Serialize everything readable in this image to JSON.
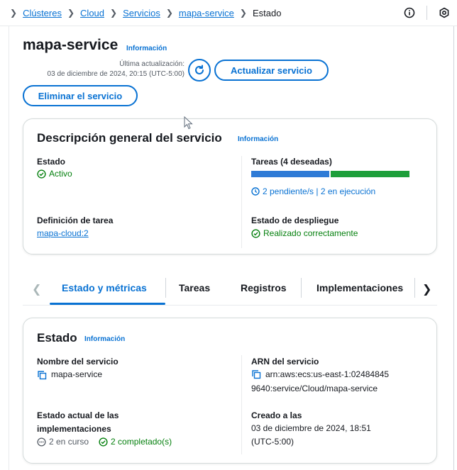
{
  "breadcrumb": {
    "items": [
      "Clústeres",
      "Cloud",
      "Servicios",
      "mapa-service"
    ],
    "current": "Estado"
  },
  "header": {
    "title": "mapa-service",
    "info": "Información",
    "last_update_label": "Última actualización:",
    "last_update_value": "03 de diciembre de 2024, 20:15 (UTC-5:00)",
    "update_button": "Actualizar servicio",
    "delete_button": "Eliminar el servicio"
  },
  "overview": {
    "title": "Descripción general del servicio",
    "info": "Información",
    "status_label": "Estado",
    "status_value": "Activo",
    "tasks_label": "Tareas (4 deseadas)",
    "tasks_summary": "2 pendiente/s | 2 en ejecución",
    "tasks_pending_fraction": 0.5,
    "tasks_running_fraction": 0.5,
    "task_def_label": "Definición de tarea",
    "task_def_value": "mapa-cloud:2",
    "deploy_label": "Estado de despliegue",
    "deploy_value": "Realizado correctamente"
  },
  "tabs": {
    "items": [
      "Estado y métricas",
      "Tareas",
      "Registros",
      "Implementaciones"
    ],
    "active": "Estado y métricas"
  },
  "status": {
    "title": "Estado",
    "info": "Información",
    "service_name_label": "Nombre del servicio",
    "service_name_value": "mapa-service",
    "arn_label": "ARN del servicio",
    "arn_line1": "arn:aws:ecs:us-east-1:02484845",
    "arn_line2": "9640:service/Cloud/mapa-service",
    "deploy_state_label_1": "Estado actual de las",
    "deploy_state_label_2": "implementaciones",
    "in_progress": "2 en curso",
    "completed": "2 completado(s)",
    "created_label": "Creado a las",
    "created_line1": "03 de diciembre de 2024, 18:51",
    "created_line2": "(UTC-5:00)"
  },
  "colors": {
    "link": "#0972d3",
    "success": "#037f0c",
    "bar_pending": "#2f7bd6",
    "bar_running": "#1e9f3b"
  },
  "icons": [
    "chevron-right-icon",
    "info-circle-icon",
    "settings-hex-icon",
    "refresh-icon",
    "check-circle-icon",
    "clock-icon",
    "copy-icon",
    "in-progress-icon",
    "chevron-left-icon"
  ]
}
